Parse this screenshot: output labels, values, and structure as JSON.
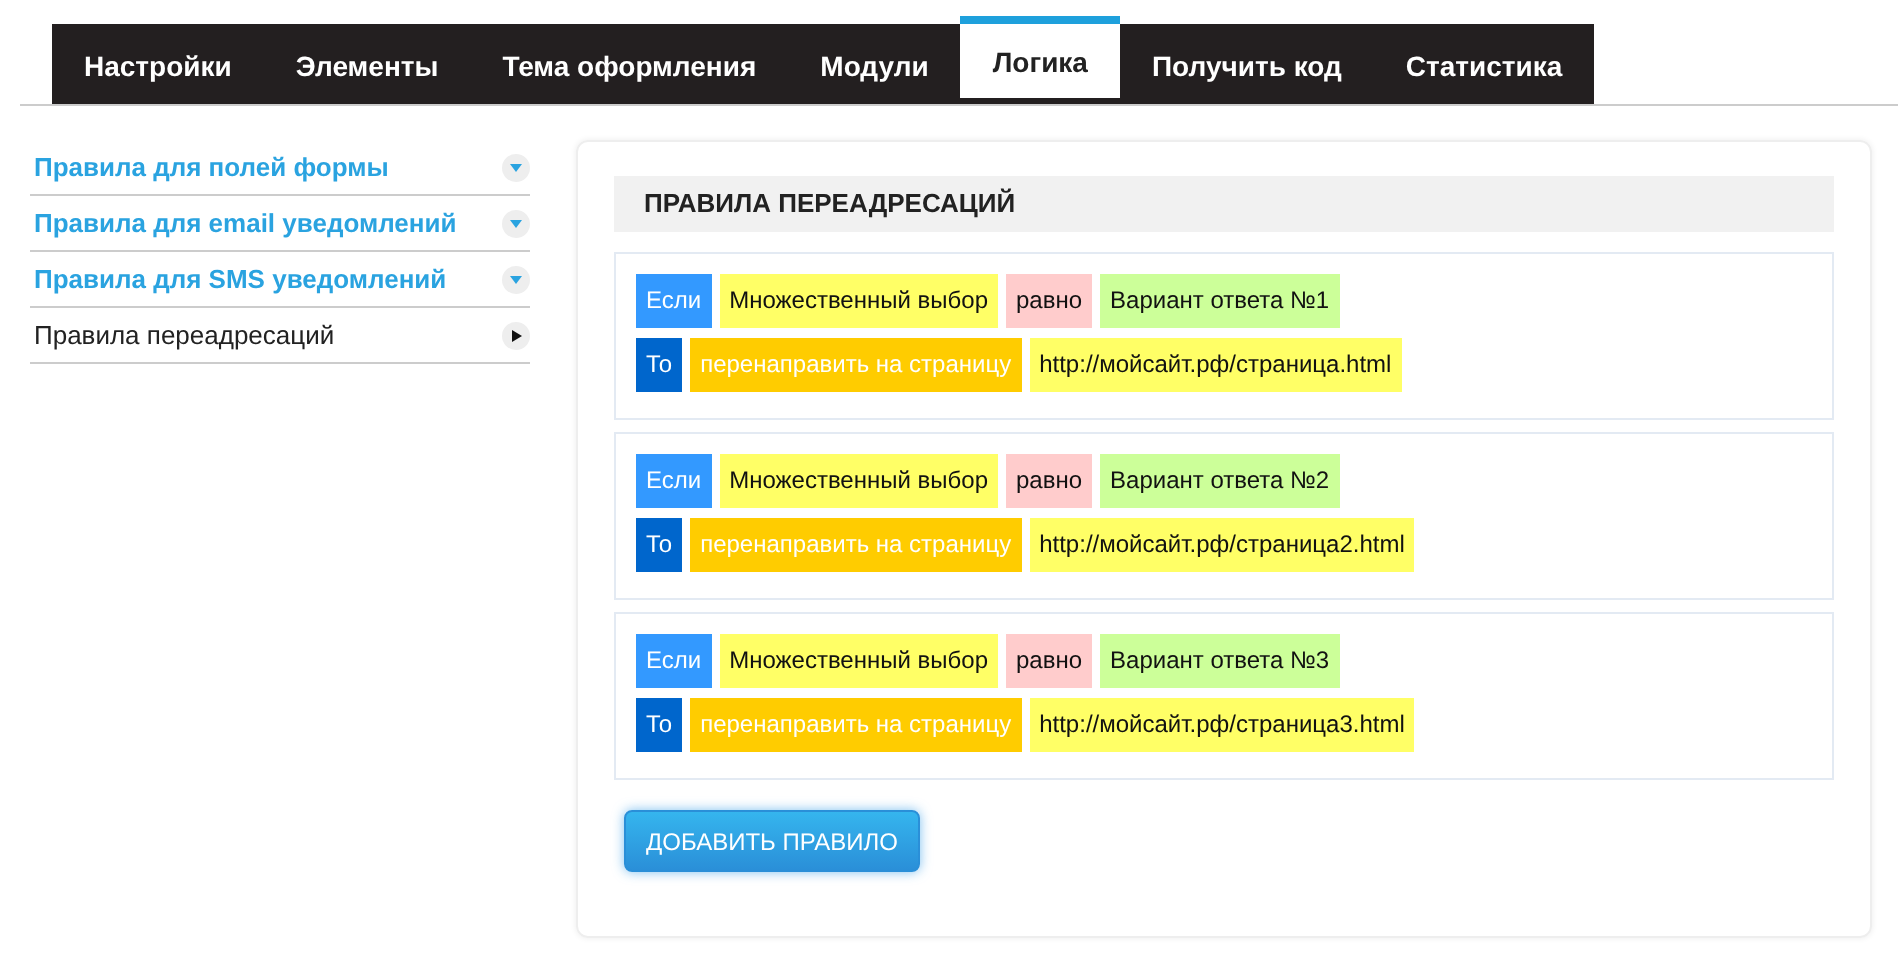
{
  "tabs": [
    {
      "label": "Настройки",
      "selected": false
    },
    {
      "label": "Элементы",
      "selected": false
    },
    {
      "label": "Тема оформления",
      "selected": false
    },
    {
      "label": "Модули",
      "selected": false
    },
    {
      "label": "Логика",
      "selected": true
    },
    {
      "label": "Получить код",
      "selected": false
    },
    {
      "label": "Статистика",
      "selected": false
    }
  ],
  "sidebar": {
    "items": [
      {
        "label": "Правила для полей формы",
        "selected": false
      },
      {
        "label": "Правила для email уведомлений",
        "selected": false
      },
      {
        "label": "Правила для SMS уведомлений",
        "selected": false
      },
      {
        "label": "Правила переадресаций",
        "selected": true
      }
    ]
  },
  "panel": {
    "title": "ПРАВИЛА ПЕРЕАДРЕСАЦИЙ",
    "rules": [
      {
        "condition": [
          {
            "kind": "if",
            "text": "Если"
          },
          {
            "kind": "field",
            "text": "Множественный выбор"
          },
          {
            "kind": "operator",
            "text": "равно"
          },
          {
            "kind": "value",
            "text": "Вариант ответа №1"
          }
        ],
        "action": [
          {
            "kind": "then",
            "text": "То"
          },
          {
            "kind": "action",
            "text": "перенаправить на страницу"
          },
          {
            "kind": "url",
            "text": "http://мойсайт.рф/страница.html"
          }
        ]
      },
      {
        "condition": [
          {
            "kind": "if",
            "text": "Если"
          },
          {
            "kind": "field",
            "text": "Множественный выбор"
          },
          {
            "kind": "operator",
            "text": "равно"
          },
          {
            "kind": "value",
            "text": "Вариант ответа №2"
          }
        ],
        "action": [
          {
            "kind": "then",
            "text": "То"
          },
          {
            "kind": "action",
            "text": "перенаправить на страницу"
          },
          {
            "kind": "url",
            "text": "http://мойсайт.рф/страница2.html"
          }
        ]
      },
      {
        "condition": [
          {
            "kind": "if",
            "text": "Если"
          },
          {
            "kind": "field",
            "text": "Множественный выбор"
          },
          {
            "kind": "operator",
            "text": "равно"
          },
          {
            "kind": "value",
            "text": "Вариант ответа №3"
          }
        ],
        "action": [
          {
            "kind": "then",
            "text": "То"
          },
          {
            "kind": "action",
            "text": "перенаправить на страницу"
          },
          {
            "kind": "url",
            "text": "http://мойсайт.рф/страница3.html"
          }
        ]
      }
    ],
    "add_button": "ДОБАВИТЬ ПРАВИЛО"
  }
}
